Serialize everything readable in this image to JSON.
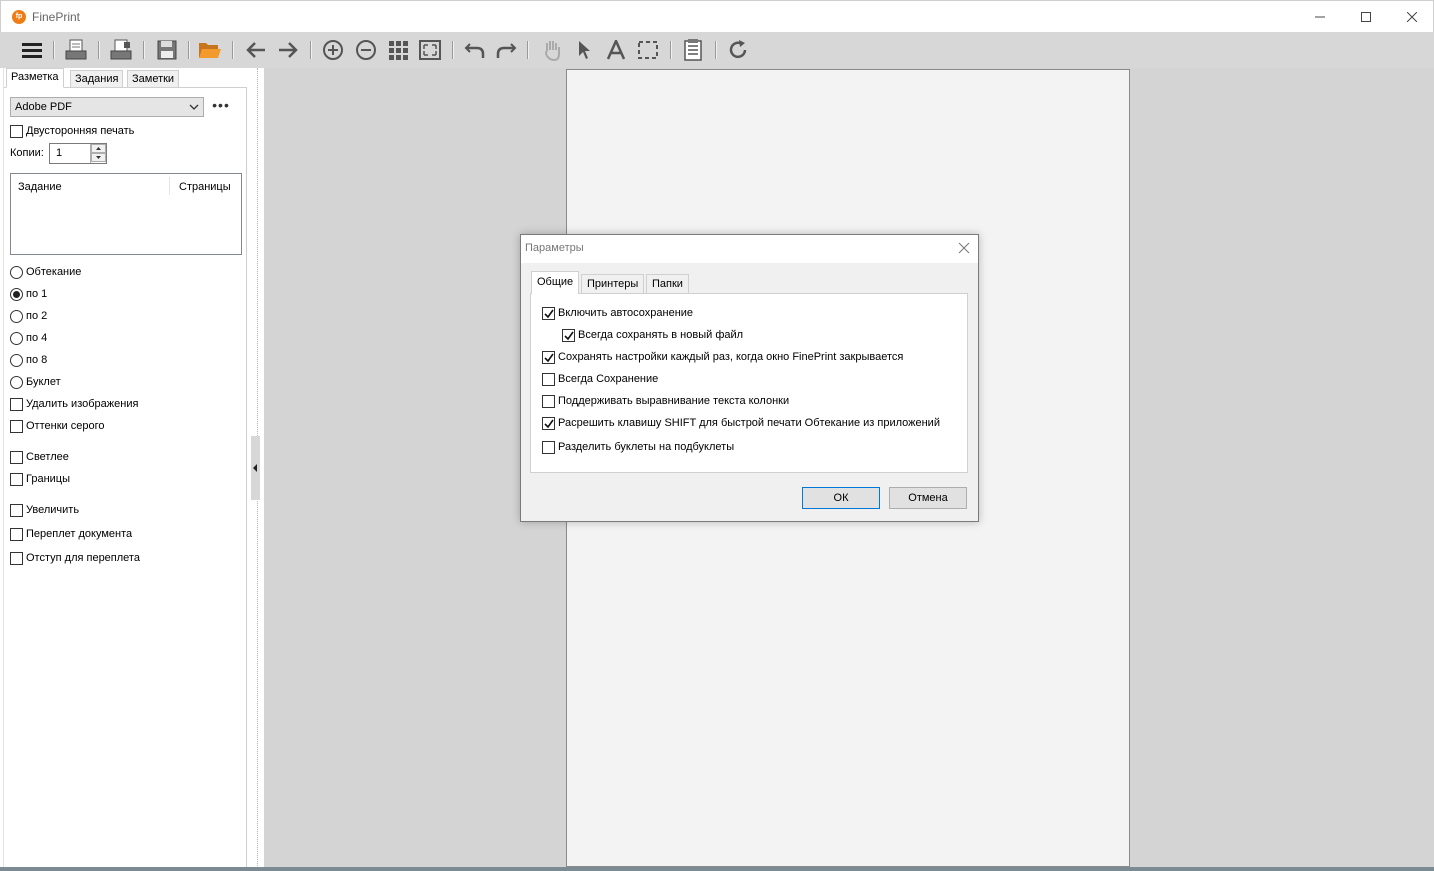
{
  "app": {
    "title": "FinePrint",
    "logo_text": "fp",
    "accent_color": "#f07c16"
  },
  "window_controls": {
    "minimize_icon": "minimize-icon",
    "maximize_icon": "maximize-icon",
    "close_icon": "close-icon"
  },
  "toolbar": {
    "icons": [
      "menu-icon",
      "print-icon",
      "print-settings-icon",
      "save-icon",
      "open-folder-icon",
      "back-icon",
      "forward-icon",
      "zoom-in-icon",
      "zoom-out-icon",
      "grid-icon",
      "fit-page-icon",
      "undo-icon",
      "redo-icon",
      "hand-icon",
      "pointer-icon",
      "text-icon",
      "select-icon",
      "notes-icon",
      "refresh-icon"
    ]
  },
  "left_panel": {
    "tabs": [
      {
        "label": "Разметка",
        "active": true
      },
      {
        "label": "Задания",
        "active": false
      },
      {
        "label": "Заметки",
        "active": false
      }
    ],
    "printer": "Adobe PDF",
    "more_label": "•••",
    "duplex_label": "Двусторонняя печать",
    "duplex_checked": false,
    "copies_label": "Копии:",
    "copies_value": "1",
    "job_list": {
      "col_job": "Задание",
      "col_pages": "Страницы"
    },
    "layout_options": [
      {
        "label": "Обтекание",
        "selected": false
      },
      {
        "label": "по 1",
        "selected": true
      },
      {
        "label": "по 2",
        "selected": false
      },
      {
        "label": "по 4",
        "selected": false
      },
      {
        "label": "по 8",
        "selected": false
      },
      {
        "label": "Буклет",
        "selected": false
      }
    ],
    "checks_a": [
      {
        "label": "Удалить изображения",
        "checked": false
      },
      {
        "label": "Оттенки серого",
        "checked": false
      }
    ],
    "checks_b": [
      {
        "label": "Светлее",
        "checked": false
      },
      {
        "label": "Границы",
        "checked": false
      }
    ],
    "checks_c": [
      {
        "label": "Увеличить",
        "checked": false
      },
      {
        "label": "Переплет документа",
        "checked": false
      },
      {
        "label": "Отступ для переплета",
        "checked": false
      }
    ]
  },
  "dialog": {
    "title": "Параметры",
    "tabs": [
      {
        "label": "Общие",
        "active": true
      },
      {
        "label": "Принтеры",
        "active": false
      },
      {
        "label": "Папки",
        "active": false
      }
    ],
    "options": [
      {
        "label": "Включить автосохранение",
        "checked": true,
        "indent": false
      },
      {
        "label": "Всегда сохранять в новый файл",
        "checked": true,
        "indent": true
      },
      {
        "label": "Сохранять настройки каждый раз, когда окно FinePrint закрывается",
        "checked": true,
        "indent": false
      },
      {
        "label": "Всегда Сохранение",
        "checked": false,
        "indent": false
      },
      {
        "label": "Поддерживать выравнивание текста колонки",
        "checked": false,
        "indent": false
      },
      {
        "label": "Расрешить клавишу SHIFT для быстрой печати Обтекание из приложений",
        "checked": true,
        "indent": false
      },
      {
        "label": "Разделить буклеты на подбуклеты",
        "checked": false,
        "indent": false
      }
    ],
    "ok_label": "ОК",
    "cancel_label": "Отмена"
  }
}
